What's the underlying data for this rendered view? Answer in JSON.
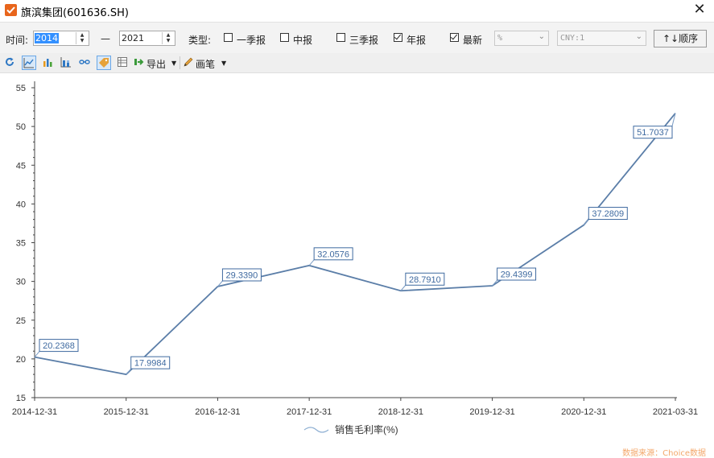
{
  "window": {
    "title": "旗滨集团(601636.SH)"
  },
  "filters": {
    "time_label": "时间:",
    "start_year": "2014",
    "dash": "—",
    "end_year": "2021",
    "type_label": "类型:",
    "options": [
      {
        "label": "一季报",
        "checked": false
      },
      {
        "label": "中报",
        "checked": false
      },
      {
        "label": "三季报",
        "checked": false
      },
      {
        "label": "年报",
        "checked": true
      },
      {
        "label": "最新",
        "checked": true
      }
    ],
    "unit_select": "%",
    "currency_select": "CNY:1",
    "sort_button": "↑↓顺序"
  },
  "toolbar": {
    "export_label": "导出",
    "pen_label": "画笔",
    "icons": [
      "refresh-icon",
      "line-chart-icon",
      "bar-chart-icon",
      "stacked-bar-icon",
      "link-icon",
      "tag-icon",
      "table-icon"
    ]
  },
  "chart_data": {
    "type": "line",
    "x": [
      "2014-12-31",
      "2015-12-31",
      "2016-12-31",
      "2017-12-31",
      "2018-12-31",
      "2019-12-31",
      "2020-12-31",
      "2021-03-31"
    ],
    "series": [
      {
        "name": "销售毛利率(%)",
        "values": [
          20.2368,
          17.9984,
          29.339,
          32.0576,
          28.791,
          29.4399,
          37.2809,
          51.7037
        ]
      }
    ],
    "yticks": [
      15,
      20,
      25,
      30,
      35,
      40,
      45,
      50,
      55
    ],
    "ylim": [
      15,
      55
    ],
    "grid": false,
    "legend_position": "bottom-center",
    "line_color": "#5b7ea8",
    "label_color": "#3f6aa0"
  },
  "footer": {
    "source": "数据来源：Choice数据"
  }
}
